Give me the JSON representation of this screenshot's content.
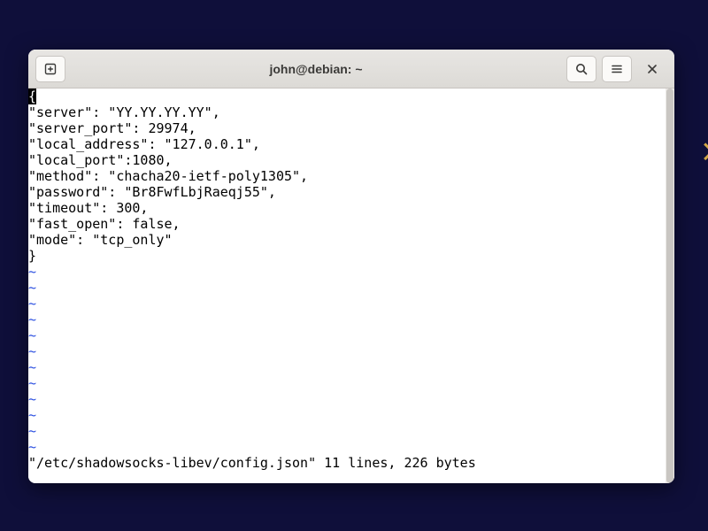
{
  "window": {
    "title": "john@debian: ~"
  },
  "terminal": {
    "lines": [
      "{",
      "\"server\": \"YY.YY.YY.YY\",",
      "\"server_port\": 29974,",
      "\"local_address\": \"127.0.0.1\",",
      "\"local_port\":1080,",
      "\"method\": \"chacha20-ietf-poly1305\",",
      "\"password\": \"Br8FwfLbjRaeqj55\",",
      "\"timeout\": 300,",
      "\"fast_open\": false,",
      "\"mode\": \"tcp_only\"",
      "}"
    ],
    "tilde_count": 12,
    "status": "\"/etc/shadowsocks-libev/config.json\" 11 lines, 226 bytes"
  },
  "icons": {
    "new_tab": "new-tab-icon",
    "search": "search-icon",
    "menu": "hamburger-icon",
    "close": "close-icon"
  }
}
